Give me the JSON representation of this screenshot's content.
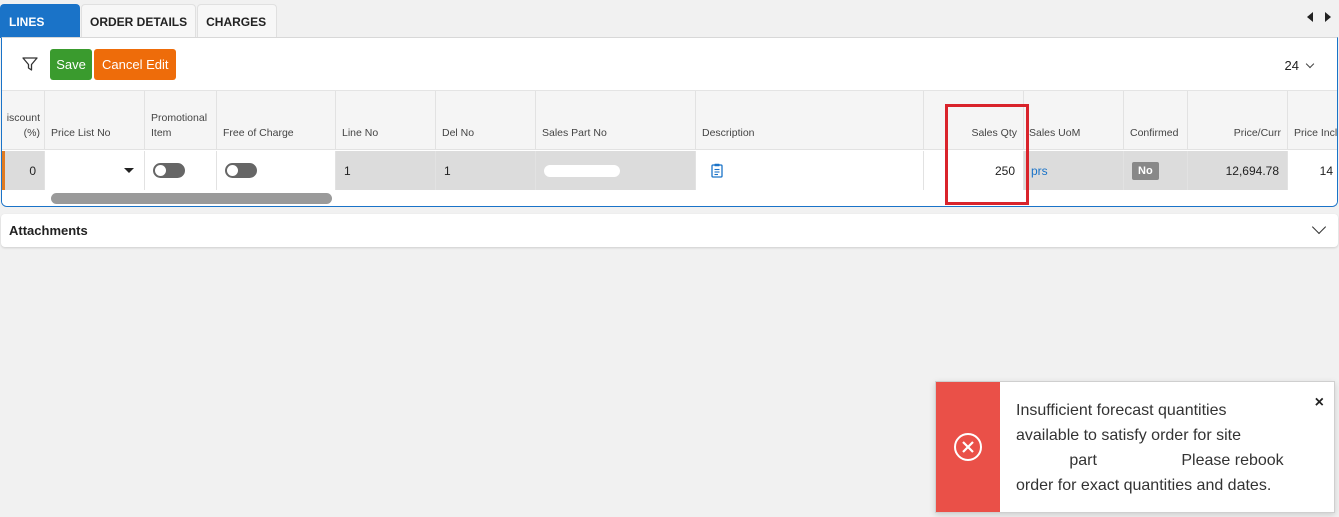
{
  "tabs": [
    {
      "label": "LINES"
    },
    {
      "label": "ORDER DETAILS"
    },
    {
      "label": "CHARGES"
    }
  ],
  "toolbar": {
    "save_label": "Save",
    "cancel_label": "Cancel Edit",
    "page_size": "24"
  },
  "columns": [
    {
      "label": "iscount\n(%)"
    },
    {
      "label": "Price List No"
    },
    {
      "label": "Promotional\nItem"
    },
    {
      "label": "Free of Charge"
    },
    {
      "label": "Line No"
    },
    {
      "label": "Del No"
    },
    {
      "label": "Sales Part No"
    },
    {
      "label": "Description"
    },
    {
      "label": "Sales Qty"
    },
    {
      "label": "Sales UoM"
    },
    {
      "label": "Confirmed"
    },
    {
      "label": "Price/Curr"
    },
    {
      "label": "Price Incl"
    }
  ],
  "row": {
    "discount": "0",
    "price_list_no": "",
    "promotional_item": false,
    "free_of_charge": false,
    "line_no": "1",
    "del_no": "1",
    "sales_qty": "250",
    "sales_uom": "prs",
    "confirmed": "No",
    "price_curr": "12,694.78",
    "price_incl": "14"
  },
  "attachments": {
    "title": "Attachments"
  },
  "toast": {
    "message": "Insufficient forecast quantities\navailable to satisfy order for site\n            part                   Please rebook\norder for exact quantities and dates.",
    "close": "×"
  },
  "colors": {
    "accent": "#1a73c8",
    "save": "#3a9b2e",
    "cancel": "#ee6c0a",
    "error": "#ea5048",
    "highlight": "#d9232b"
  }
}
